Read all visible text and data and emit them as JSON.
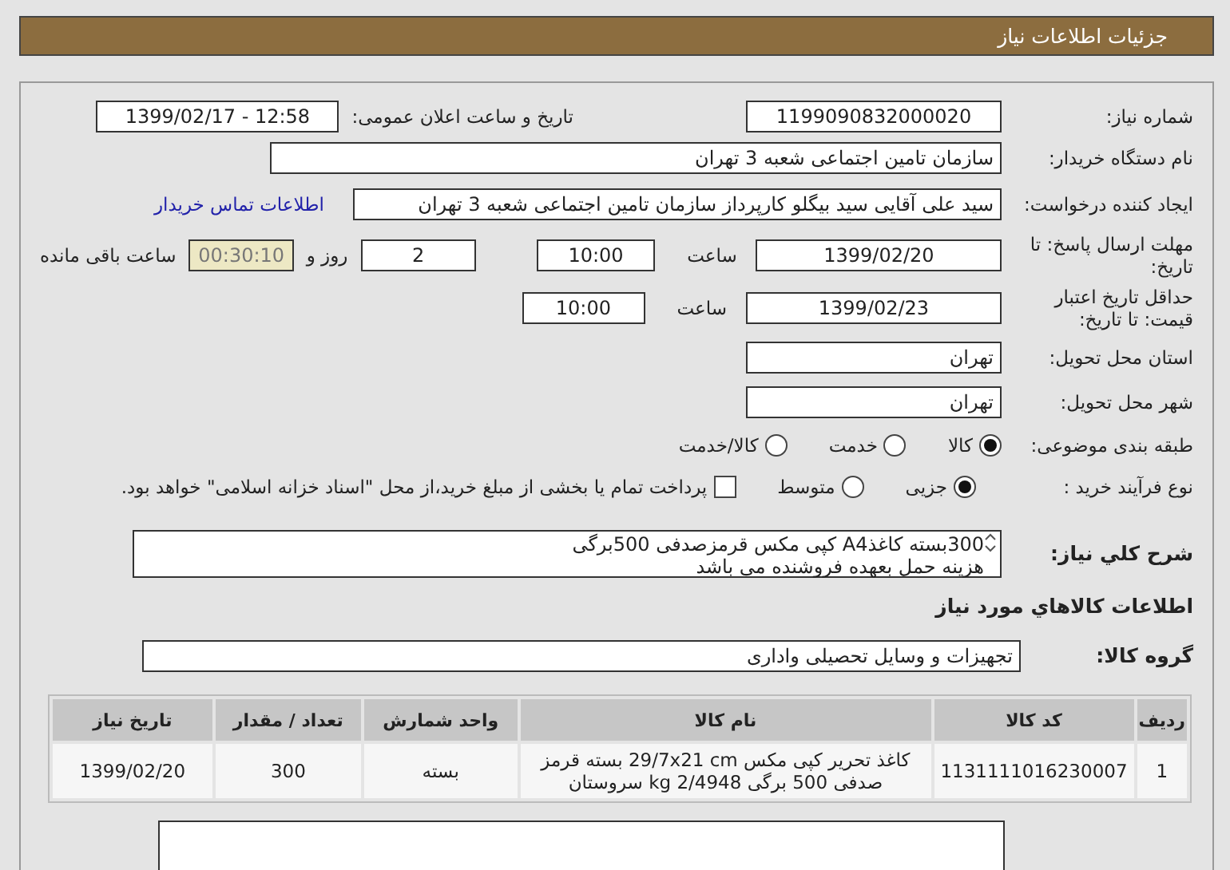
{
  "header": {
    "title": "جزئیات اطلاعات نیاز"
  },
  "form": {
    "need_number": {
      "label": "شماره نیاز:",
      "value": "1199090832000020"
    },
    "announce": {
      "label": "تاریخ و ساعت اعلان عمومی:",
      "value": "1399/02/17 - 12:58"
    },
    "buyer": {
      "label": "نام دستگاه خریدار:",
      "value": "سازمان تامین اجتماعی شعبه 3 تهران"
    },
    "creator": {
      "label": "ایجاد کننده درخواست:",
      "value": "سید علی آقایی سید بیگلو کارپرداز سازمان تامین اجتماعی شعبه 3 تهران",
      "link": "اطلاعات تماس خریدار"
    },
    "deadline": {
      "label": "مهلت ارسال پاسخ: تا تاریخ:",
      "date": "1399/02/20",
      "time_label": "ساعت",
      "time": "10:00",
      "days": "2",
      "days_label": "روز و",
      "remaining": "00:30:10",
      "remaining_label": "ساعت باقی مانده"
    },
    "validity": {
      "label": "حداقل تاریخ اعتبار قیمت: تا تاریخ:",
      "date": "1399/02/23",
      "time_label": "ساعت",
      "time": "10:00"
    },
    "province": {
      "label": "استان محل تحویل:",
      "value": "تهران"
    },
    "city": {
      "label": "شهر محل تحویل:",
      "value": "تهران"
    },
    "category": {
      "label": "طبقه بندی موضوعی:",
      "options": [
        {
          "label": "کالا",
          "selected": true
        },
        {
          "label": "خدمت",
          "selected": false
        },
        {
          "label": "کالا/خدمت",
          "selected": false
        }
      ]
    },
    "process": {
      "label": "نوع فرآیند خرید :",
      "options": [
        {
          "label": "جزیی",
          "selected": true
        },
        {
          "label": "متوسط",
          "selected": false
        }
      ],
      "treasury": {
        "label": "پرداخت تمام یا بخشی از مبلغ خرید،از محل \"اسناد خزانه اسلامی\" خواهد بود.",
        "checked": false
      }
    }
  },
  "description": {
    "label": "شرح کلي نياز:",
    "lines": [
      "300بسته کاغذA4 کپی مکس قرمزصدفی 500برگی",
      "هزینه حمل بعهده فروشنده می باشد"
    ]
  },
  "goods": {
    "heading": "اطلاعات کالاهاي مورد نياز",
    "group_label": "گروه کالا:",
    "group": "تجهیزات و وسایل تحصیلی واداری"
  },
  "table": {
    "columns": [
      "ردیف",
      "کد کالا",
      "نام کالا",
      "واحد شمارش",
      "تعداد / مقدار",
      "تاریخ نیاز"
    ],
    "rows": [
      {
        "cells": [
          "1",
          "1131111016230007",
          "کاغذ تحریر کپی مکس 29/7x21 cm بسته قرمز صدفی 500 برگی 2/4948 kg سروستان",
          "بسته",
          "300",
          "1399/02/20"
        ]
      }
    ]
  }
}
